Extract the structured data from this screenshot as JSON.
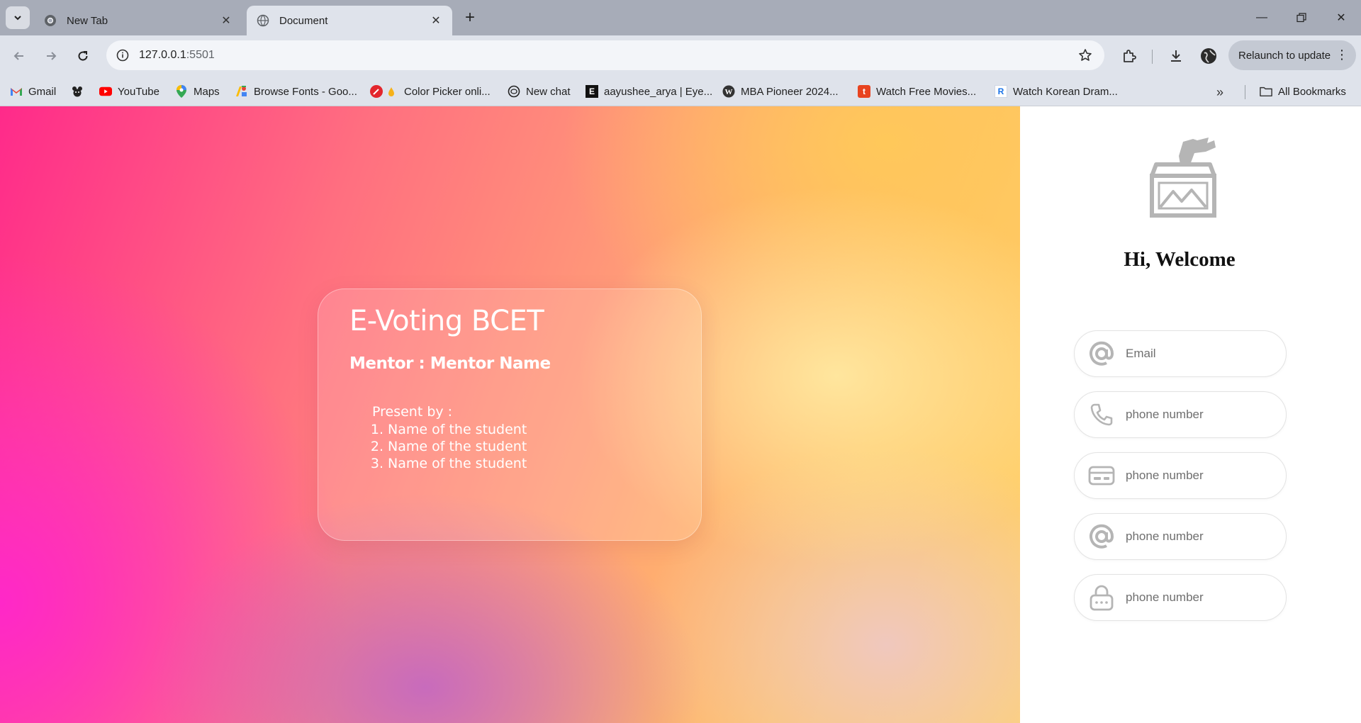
{
  "browser": {
    "tabs": [
      {
        "title": "New Tab",
        "icon": "chrome-icon",
        "active": false
      },
      {
        "title": "Document",
        "icon": "globe-icon",
        "active": true
      }
    ],
    "url_host": "127.0.0.1",
    "url_port": ":5501",
    "relaunch_label": "Relaunch to update",
    "bookmarks": [
      {
        "label": "Gmail",
        "icon": "gmail-icon"
      },
      {
        "label": "",
        "icon": "bear-icon"
      },
      {
        "label": "YouTube",
        "icon": "youtube-icon"
      },
      {
        "label": "Maps",
        "icon": "maps-icon"
      },
      {
        "label": "Browse Fonts - Goo...",
        "icon": "google-fonts-icon"
      },
      {
        "label": "Color Picker onli...",
        "icon": "color-picker-icon"
      },
      {
        "label": "New chat",
        "icon": "chatgpt-icon"
      },
      {
        "label": "aayushee_arya | Eye...",
        "icon": "e-icon"
      },
      {
        "label": "MBA Pioneer 2024...",
        "icon": "wordpress-icon"
      },
      {
        "label": "Watch Free Movies...",
        "icon": "t-icon"
      },
      {
        "label": "Watch Korean Dram...",
        "icon": "r-icon"
      }
    ],
    "all_bookmarks_label": "All Bookmarks"
  },
  "card": {
    "title": "E-Voting BCET",
    "mentor": "Mentor : Mentor Name",
    "present_by": "Present by :",
    "students": [
      {
        "num": "1.",
        "name": "Name of the student"
      },
      {
        "num": "2.",
        "name": "Name of the student"
      },
      {
        "num": "3.",
        "name": "Name of the student"
      }
    ]
  },
  "login": {
    "welcome": "Hi, Welcome",
    "fields": [
      {
        "placeholder": "Email",
        "icon": "at-icon"
      },
      {
        "placeholder": "phone number",
        "icon": "phone-icon"
      },
      {
        "placeholder": "phone number",
        "icon": "id-card-icon"
      },
      {
        "placeholder": "phone number",
        "icon": "at-icon"
      },
      {
        "placeholder": "phone number",
        "icon": "lock-icon"
      }
    ]
  },
  "colors": {
    "hero_pink": "#ff2a8a",
    "hero_yellow": "#ffd36a",
    "icon_gray": "#b5b5b5"
  }
}
